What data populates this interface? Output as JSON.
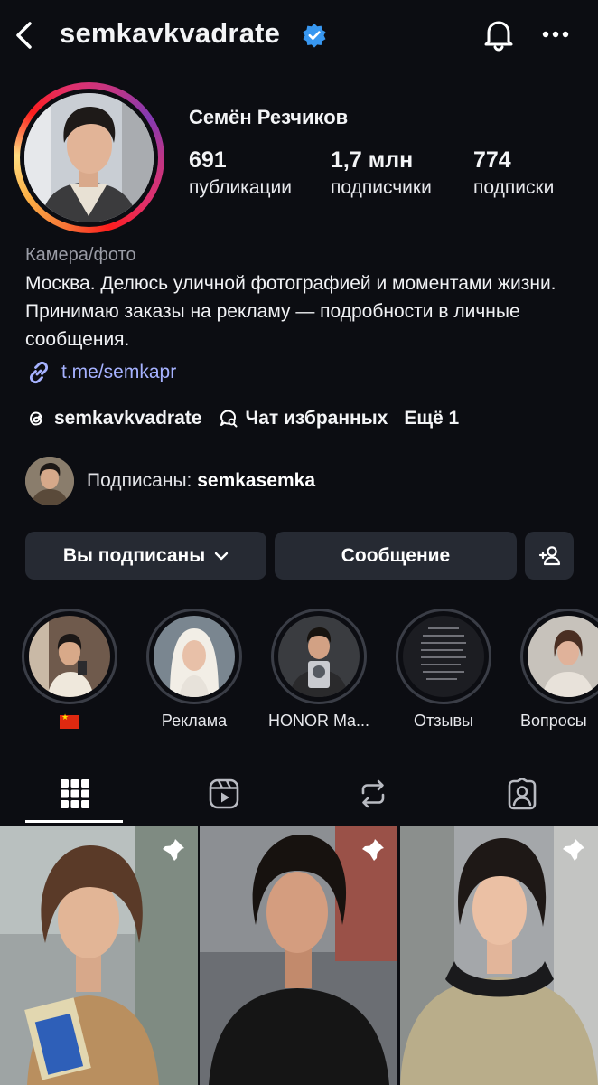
{
  "header": {
    "username": "semkavkvadrate",
    "verified": true,
    "icons": [
      "back-arrow-icon",
      "verified-badge-icon",
      "bell-icon",
      "more-options-icon"
    ]
  },
  "profile": {
    "full_name": "Семён Резчиков",
    "stats": [
      {
        "value": "691",
        "label": "публикации"
      },
      {
        "value": "1,7 млн",
        "label": "подписчики"
      },
      {
        "value": "774",
        "label": "подписки"
      }
    ],
    "category": "Камера/фото",
    "bio": "Москва. Делюсь уличной фотографией и моментами жизни. Принимаю заказы на рекламу — подробности в личные сообщения.",
    "link": "t.me/semkapr",
    "threads_handle": "semkavkvadrate",
    "chat_label": "Чат избранных",
    "more_label": "Ещё 1",
    "followed_by_prefix": "Подписаны: ",
    "followed_by_name": "semkasemka"
  },
  "actions": {
    "following_label": "Вы подписаны",
    "message_label": "Сообщение"
  },
  "highlights": [
    {
      "label": ""
    },
    {
      "label": "Реклама"
    },
    {
      "label": "HONOR Ma..."
    },
    {
      "label": "Отзывы"
    },
    {
      "label": "Вопросы"
    }
  ],
  "tabs": [
    "grid-icon",
    "reels-icon",
    "reposts-icon",
    "tagged-icon"
  ],
  "colors": {
    "background": "#0c0d12",
    "button": "#262a33",
    "link": "#a6b2ff",
    "verified": "#3897f0"
  }
}
